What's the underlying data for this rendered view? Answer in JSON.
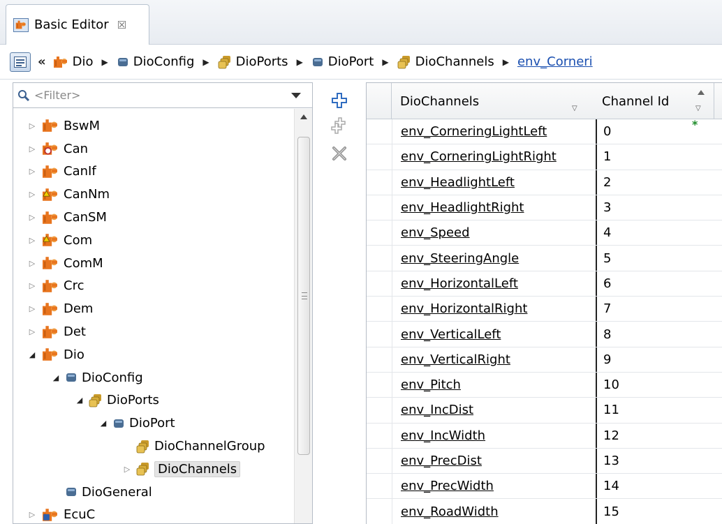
{
  "tab": {
    "title": "Basic Editor",
    "close_glyph": "☒"
  },
  "breadcrumb": {
    "back_glyph": "«",
    "items": [
      {
        "label": "Dio",
        "icon": "module-icon"
      },
      {
        "label": "DioConfig",
        "icon": "container-icon"
      },
      {
        "label": "DioPorts",
        "icon": "container-list-icon"
      },
      {
        "label": "DioPort",
        "icon": "container-icon"
      },
      {
        "label": "DioChannels",
        "icon": "container-list-icon"
      },
      {
        "label": "env_Corneri",
        "icon": "",
        "link": true
      }
    ]
  },
  "filter": {
    "placeholder": "<Filter>"
  },
  "tree": {
    "items": [
      {
        "label": "BswM",
        "level": 0,
        "twist": "closed",
        "icon": "module"
      },
      {
        "label": "Can",
        "level": 0,
        "twist": "closed",
        "icon": "module-disabled"
      },
      {
        "label": "CanIf",
        "level": 0,
        "twist": "closed",
        "icon": "module"
      },
      {
        "label": "CanNm",
        "level": 0,
        "twist": "closed",
        "icon": "module-warning"
      },
      {
        "label": "CanSM",
        "level": 0,
        "twist": "closed",
        "icon": "module"
      },
      {
        "label": "Com",
        "level": 0,
        "twist": "closed",
        "icon": "module-warning"
      },
      {
        "label": "ComM",
        "level": 0,
        "twist": "closed",
        "icon": "module"
      },
      {
        "label": "Crc",
        "level": 0,
        "twist": "closed",
        "icon": "module"
      },
      {
        "label": "Dem",
        "level": 0,
        "twist": "closed",
        "icon": "module"
      },
      {
        "label": "Det",
        "level": 0,
        "twist": "closed",
        "icon": "module"
      },
      {
        "label": "Dio",
        "level": 0,
        "twist": "open",
        "icon": "module"
      },
      {
        "label": "DioConfig",
        "level": 1,
        "twist": "open",
        "icon": "container"
      },
      {
        "label": "DioPorts",
        "level": 2,
        "twist": "open",
        "icon": "container-list"
      },
      {
        "label": "DioPort",
        "level": 3,
        "twist": "open",
        "icon": "container"
      },
      {
        "label": "DioChannelGroup",
        "level": 4,
        "twist": "none",
        "icon": "container-list"
      },
      {
        "label": "DioChannels",
        "level": 4,
        "twist": "closed",
        "icon": "container-list",
        "selected": true
      },
      {
        "label": "DioGeneral",
        "level": 1,
        "twist": "none",
        "icon": "container"
      },
      {
        "label": "EcuC",
        "level": 0,
        "twist": "closed",
        "icon": "module-lock"
      }
    ]
  },
  "toolbar": {
    "add_icon": "add-icon",
    "add_multiple_icon": "add-multiple-icon",
    "delete_icon": "delete-icon"
  },
  "table": {
    "columns": [
      "DioChannels",
      "Channel Id"
    ],
    "rows": [
      {
        "name": "env_CorneringLightLeft",
        "id": "0"
      },
      {
        "name": "env_CorneringLightRight",
        "id": "1"
      },
      {
        "name": "env_HeadlightLeft",
        "id": "2"
      },
      {
        "name": "env_HeadlightRight",
        "id": "3"
      },
      {
        "name": "env_Speed",
        "id": "4"
      },
      {
        "name": "env_SteeringAngle",
        "id": "5"
      },
      {
        "name": "env_HorizontalLeft",
        "id": "6"
      },
      {
        "name": "env_HorizontalRight",
        "id": "7"
      },
      {
        "name": "env_VerticalLeft",
        "id": "8"
      },
      {
        "name": "env_VerticalRight",
        "id": "9"
      },
      {
        "name": "env_Pitch",
        "id": "10"
      },
      {
        "name": "env_IncDist",
        "id": "11"
      },
      {
        "name": "env_IncWidth",
        "id": "12"
      },
      {
        "name": "env_PrecDist",
        "id": "13"
      },
      {
        "name": "env_PrecWidth",
        "id": "14"
      },
      {
        "name": "env_RoadWidth",
        "id": "15"
      }
    ],
    "modified_marker": "*"
  },
  "colors": {
    "module_orange": "#e8751f",
    "container_blue": "#4a6d93",
    "container_gold": "#c99a2a",
    "link_blue": "#1a4fb0",
    "add_blue": "#2f6cc0",
    "modified_green": "#1e8c2a"
  }
}
